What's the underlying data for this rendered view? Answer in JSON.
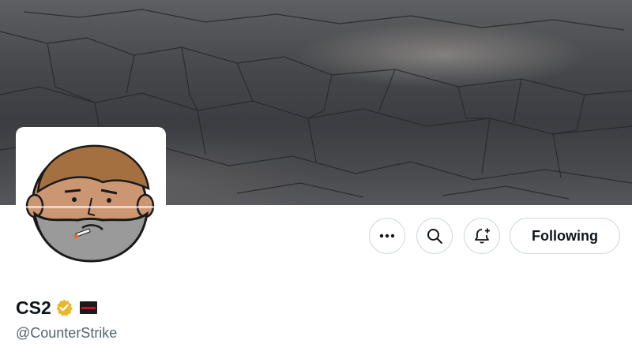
{
  "profile": {
    "display_name": "CS2",
    "handle": "@CounterStrike",
    "verified_badge": "gold-verified-icon",
    "flag_icon": "flag-icon",
    "avatar": "cartoon-bald-man-with-cigarette",
    "banner": "cracked-asphalt-banner"
  },
  "actions": {
    "more_icon": "more-icon",
    "search_icon": "search-icon",
    "notify_icon": "bell-plus-icon",
    "follow_label": "Following"
  },
  "colors": {
    "text_primary": "#0f1419",
    "text_secondary": "#536471",
    "border": "#cfd9de",
    "verified_gold": "#e8b829"
  }
}
